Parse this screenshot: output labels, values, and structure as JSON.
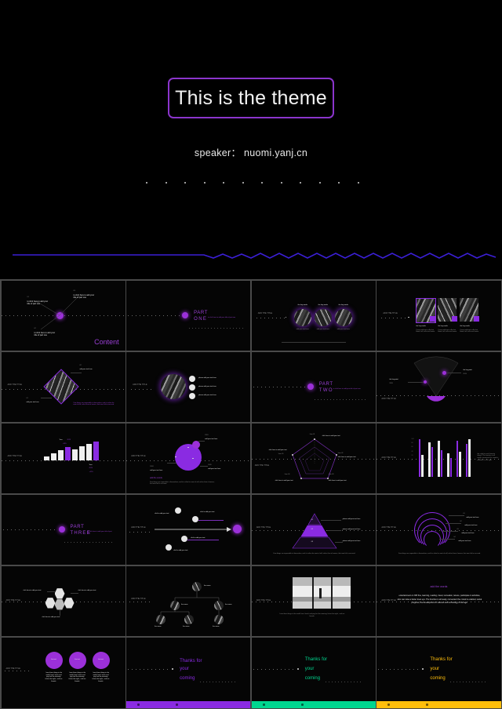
{
  "hero": {
    "title": "This is the theme",
    "speaker": "speaker： nuomi.yanj.cn",
    "dot_count": 12,
    "border_color": "#8B35CC",
    "wave_color": "#3B1FD6",
    "background": "#000000"
  },
  "theme": {
    "accent_purple": "#8A2BE2",
    "accent_green": "#00D68F",
    "accent_amber": "#FFBE0B",
    "slide_background": "#050505",
    "grid_line": "#4a4a4a"
  },
  "common": {
    "add_title": "ADD THE TITLE",
    "add_text": "add your text here",
    "lorem_short": "to click here to add your title of part one",
    "lorem_long": "Few things are impossible in themselves; and it is often for want of will, rather than of means, that men fail to succeed.",
    "key_words": "the key words"
  },
  "slides": [
    {
      "index": 1,
      "name": "content-overview",
      "title": "Content",
      "kind": "content"
    },
    {
      "index": 2,
      "name": "part-one-divider",
      "title": "PART",
      "subtitle": "ONE",
      "kind": "divider"
    },
    {
      "index": 3,
      "name": "three-circle-photos",
      "title": "ADD THE TITLE",
      "kind": "photo-circles",
      "items": [
        {
          "heading": "the key words",
          "body": "add your text here\nadd your text here"
        },
        {
          "heading": "the key words",
          "body": "add your text here\nadd your text here"
        },
        {
          "heading": "the key words",
          "body": "add your text here\nadd your text here"
        }
      ]
    },
    {
      "index": 4,
      "name": "three-card-photos",
      "title": "ADD THE TITLE",
      "kind": "photo-cards",
      "items": [
        {
          "heading": "the key words",
          "body": "I have nothing to offer but blood, toil, tears and sweat"
        },
        {
          "heading": "the key words",
          "body": "I have nothing to offer but blood, toil, tears and sweat"
        },
        {
          "heading": "the key words",
          "body": "I have nothing to offer but blood, toil, tears and sweat"
        }
      ]
    },
    {
      "index": 5,
      "name": "diamond-photo",
      "title": "ADD THE TITLE",
      "kind": "diamond",
      "caption": "Few things are impossible in themselves; and it is often for want of will, rather than of means, that men fail to succeed."
    },
    {
      "index": 6,
      "name": "circle-photo-list",
      "title": "ADD THE TITLE",
      "kind": "circle-list",
      "items": [
        {
          "body": "please add your text here"
        },
        {
          "body": "please add your text here"
        },
        {
          "body": "please add your text here"
        }
      ]
    },
    {
      "index": 7,
      "name": "part-two-divider",
      "title": "PART",
      "subtitle": "TWO",
      "kind": "divider"
    },
    {
      "index": 8,
      "name": "fan-chart",
      "title": "ADD THE TITLE",
      "kind": "fan",
      "items": [
        {
          "label": "the key point",
          "body": "2019"
        },
        {
          "label": "the key point",
          "body": "2020"
        }
      ]
    },
    {
      "index": 9,
      "name": "bar-chart",
      "title": "ADD THE TITLE",
      "kind": "bars",
      "values": [
        18,
        30,
        42,
        56,
        48,
        60,
        70,
        82
      ]
    },
    {
      "index": 10,
      "name": "pie-chart",
      "title": "ADD THE TITLE",
      "kind": "pie",
      "heading": "add the words",
      "caption": "Few things are impossible in themselves; and it is often for want of will, rather than of means, that men fail to succeed."
    },
    {
      "index": 11,
      "name": "radar-chart",
      "title": "ADD THE TITLE",
      "kind": "radar",
      "labels": [
        "click here to add your text",
        "click here to add your text",
        "click here to add your text",
        "click here to add your text",
        "click here to add your text"
      ]
    },
    {
      "index": 12,
      "name": "column-chart",
      "title": "ADD THE TITLE",
      "kind": "columns",
      "values": [
        70,
        55,
        62,
        40,
        66,
        58
      ],
      "caption": "the color for each favorite things? The function is all ready, convenient the crowd is enabled, it is all right."
    },
    {
      "index": 13,
      "name": "part-three-divider",
      "title": "PART",
      "subtitle": "THREE",
      "kind": "divider"
    },
    {
      "index": 14,
      "name": "timeline",
      "title": "ADD THE TITLE",
      "kind": "timeline",
      "items": [
        {
          "body": "click to add your text"
        },
        {
          "body": "click to add your text"
        },
        {
          "body": "click to add your text"
        },
        {
          "body": "click to add your text"
        }
      ]
    },
    {
      "index": 15,
      "name": "pyramid-chart",
      "title": "ADD THE TITLE",
      "kind": "pyramid",
      "items": [
        {
          "body": "please add your text here"
        },
        {
          "body": "please add your text here"
        },
        {
          "body": "please add your text here"
        }
      ],
      "caption": "Few things are impossible in themselves; and it is often for want of will, rather than of means, that men fail to succeed."
    },
    {
      "index": 16,
      "name": "arc-chart",
      "title": "ADD THE TITLE",
      "kind": "arcs",
      "items": [
        {
          "body": "add your text here"
        },
        {
          "body": "add your text here"
        },
        {
          "body": "add your text here"
        },
        {
          "body": "add your text here"
        }
      ],
      "caption": "Few things are impossible in themselves; and it is often for want of will, rather than of means, that men fail to succeed."
    },
    {
      "index": 17,
      "name": "hexagon-icons",
      "title": "ADD THE TITLE",
      "kind": "hexes",
      "items": [
        {
          "body": "click here to add your text"
        },
        {
          "body": "click here to add your text"
        },
        {
          "body": "click here to add your text"
        }
      ]
    },
    {
      "index": 18,
      "name": "org-chart",
      "title": "ADD THE TITLE",
      "kind": "org",
      "items": [
        {
          "label": "the name"
        },
        {
          "label": "the name"
        },
        {
          "label": "the name"
        },
        {
          "label": "the name"
        },
        {
          "label": "the name"
        },
        {
          "label": "the name"
        }
      ]
    },
    {
      "index": 19,
      "name": "panorama-photo",
      "title": "ADD THE TITLE",
      "kind": "panorama",
      "caption": "I saw three things in the world: how I teach and pay, but the morning, future the night , and our friends."
    },
    {
      "index": 20,
      "name": "text-slide",
      "title": "ADD THE TITLE",
      "kind": "text",
      "heading": "add the words",
      "caption": "entertainment on 365 fine, learning, reading, travel, recreation, leisure, participate in activities, who can raise a better level eye. The function is all ready, convenient the crowd is enabled, social progress, the development of science and technology of the age."
    },
    {
      "index": 21,
      "name": "three-circle-stats",
      "title": "ADD THE TITLE",
      "kind": "stat-circles",
      "items": [
        {
          "label": "the text",
          "body": "I saw three things in the world: how I teach and pay, but the morning, future the night , and our friends."
        },
        {
          "label": "the text",
          "body": "I saw three things in the world: how I teach and pay, but the morning, future the night , and our friends."
        },
        {
          "label": "the text",
          "body": "I saw three things in the world: how I teach and pay, but the morning, future the night , and our friends."
        }
      ]
    },
    {
      "index": 22,
      "name": "thanks-purple",
      "kind": "thanks",
      "lines": [
        "Thanks for",
        "your",
        "coming"
      ],
      "color": "#8A2BE2"
    },
    {
      "index": 23,
      "name": "thanks-green",
      "kind": "thanks",
      "lines": [
        "Thanks for",
        "your",
        "coming"
      ],
      "color": "#00D68F"
    },
    {
      "index": 24,
      "name": "thanks-amber",
      "kind": "thanks",
      "lines": [
        "Thanks for",
        "your",
        "coming"
      ],
      "color": "#FFBE0B"
    }
  ]
}
